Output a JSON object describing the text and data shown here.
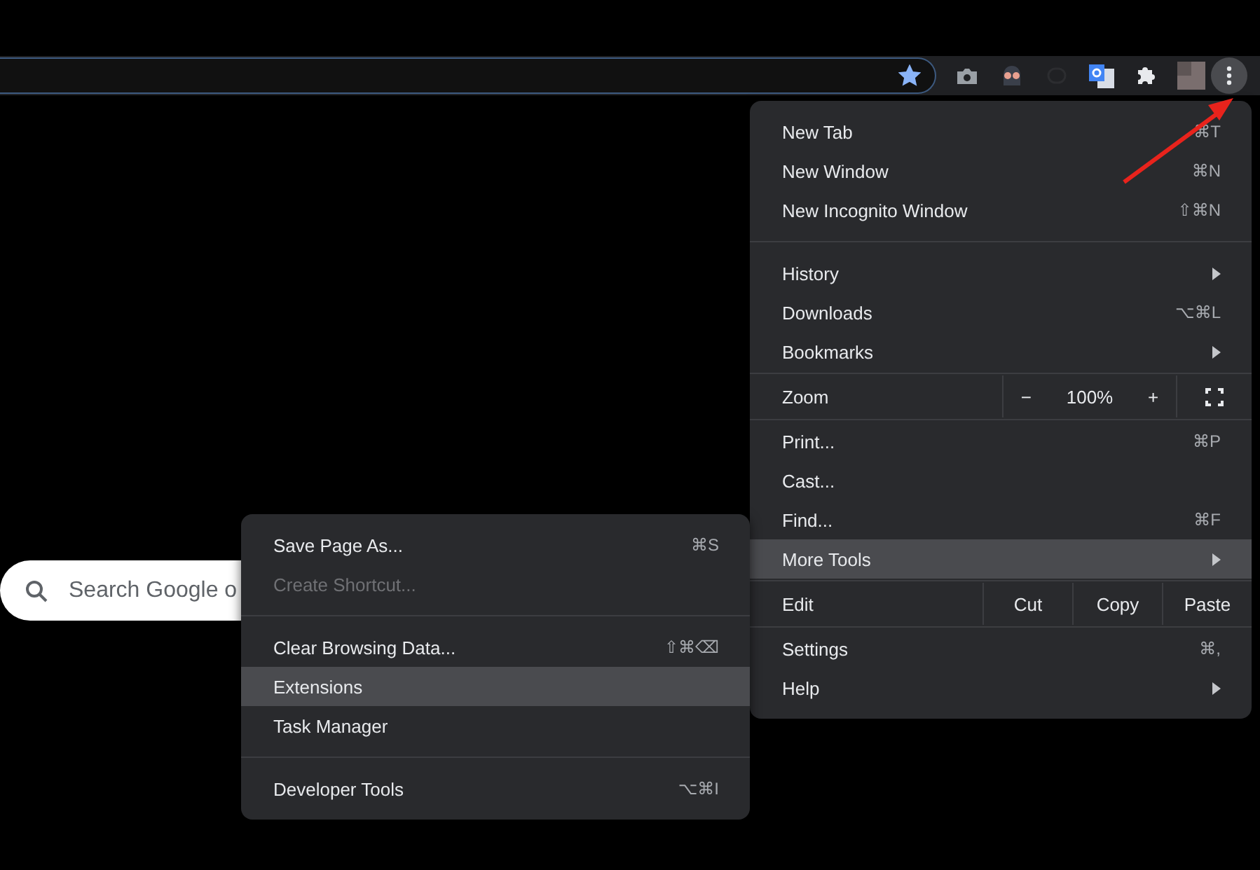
{
  "toolbar": {
    "bookmarked": true,
    "menu_button_pressed": true
  },
  "search": {
    "placeholder": "Search Google o"
  },
  "menu": {
    "sections": [
      {
        "items": [
          {
            "kind": "item",
            "label": "New Tab",
            "shortcut": "⌘T",
            "highlighted": false
          },
          {
            "kind": "item",
            "label": "New Window",
            "shortcut": "⌘N",
            "highlighted": false
          },
          {
            "kind": "item",
            "label": "New Incognito Window",
            "shortcut": "⇧⌘N",
            "highlighted": false
          }
        ]
      },
      {
        "items": [
          {
            "kind": "item",
            "label": "History",
            "submenu": true,
            "highlighted": false
          },
          {
            "kind": "item",
            "label": "Downloads",
            "shortcut": "⌥⌘L",
            "highlighted": false
          },
          {
            "kind": "item",
            "label": "Bookmarks",
            "submenu": true,
            "highlighted": false
          }
        ]
      },
      {
        "items": [
          {
            "kind": "zoom",
            "label": "Zoom",
            "minus": "−",
            "value": "100%",
            "plus": "+"
          }
        ]
      },
      {
        "items": [
          {
            "kind": "item",
            "label": "Print...",
            "shortcut": "⌘P",
            "highlighted": false
          },
          {
            "kind": "item",
            "label": "Cast...",
            "highlighted": false
          },
          {
            "kind": "item",
            "label": "Find...",
            "shortcut": "⌘F",
            "highlighted": false
          },
          {
            "kind": "item",
            "label": "More Tools",
            "submenu": true,
            "highlighted": true
          }
        ]
      },
      {
        "items": [
          {
            "kind": "edit",
            "label": "Edit",
            "actions": [
              "Cut",
              "Copy",
              "Paste"
            ]
          }
        ]
      },
      {
        "items": [
          {
            "kind": "item",
            "label": "Settings",
            "shortcut": "⌘,",
            "highlighted": false
          },
          {
            "kind": "item",
            "label": "Help",
            "submenu": true,
            "highlighted": false
          }
        ]
      }
    ]
  },
  "submenu": {
    "sections": [
      {
        "items": [
          {
            "label": "Save Page As...",
            "shortcut": "⌘S",
            "disabled": false,
            "highlighted": false
          },
          {
            "label": "Create Shortcut...",
            "disabled": true,
            "highlighted": false
          }
        ]
      },
      {
        "items": [
          {
            "label": "Clear Browsing Data...",
            "shortcut": "⇧⌘⌫",
            "disabled": false,
            "highlighted": false
          },
          {
            "label": "Extensions",
            "disabled": false,
            "highlighted": true
          },
          {
            "label": "Task Manager",
            "disabled": false,
            "highlighted": false
          }
        ]
      },
      {
        "items": [
          {
            "label": "Developer Tools",
            "shortcut": "⌥⌘I",
            "disabled": false,
            "highlighted": false
          }
        ]
      }
    ]
  }
}
